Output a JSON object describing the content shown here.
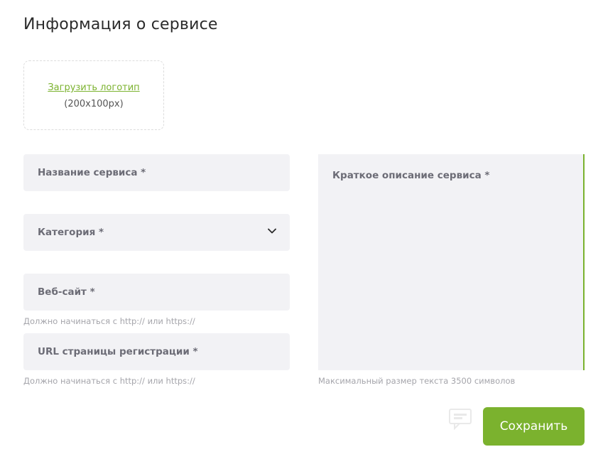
{
  "page": {
    "title": "Информация о сервисе"
  },
  "logo_upload": {
    "link_label": "Загрузить логотип",
    "size_hint": "(200x100px)"
  },
  "form": {
    "service_name": {
      "label": "Название сервиса *"
    },
    "category": {
      "label": "Категория *",
      "icon": "chevron-down-icon"
    },
    "website": {
      "label": "Веб-сайт *",
      "hint": "Должно начинаться с http:// или https://"
    },
    "registration_url": {
      "label": "URL страницы регистрации *",
      "hint": "Должно начинаться с http:// или https://"
    },
    "description": {
      "label": "Краткое описание сервиса *",
      "hint": "Максимальный размер текста 3500 символов"
    }
  },
  "actions": {
    "save_label": "Сохранить"
  },
  "colors": {
    "accent": "#7bb22e",
    "field_bg": "#f2f2f5"
  }
}
